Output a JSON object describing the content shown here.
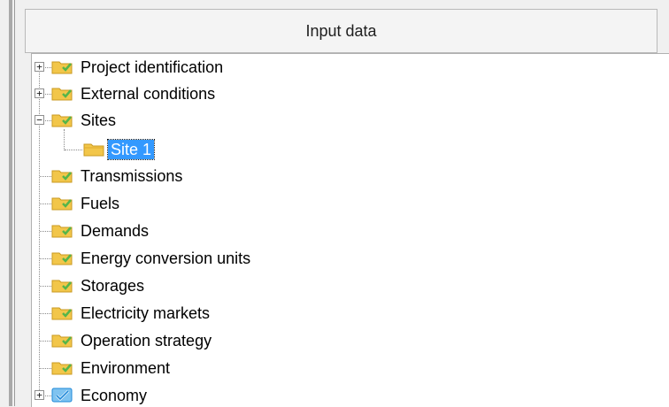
{
  "header": {
    "title": "Input data"
  },
  "tree": {
    "items": [
      {
        "label": "Project identification",
        "expander": "+",
        "icon": "folder-checked-icon"
      },
      {
        "label": "External conditions",
        "expander": "+",
        "icon": "folder-checked-icon"
      },
      {
        "label": "Sites",
        "expander": "−",
        "icon": "folder-checked-icon"
      },
      {
        "label": "Site 1",
        "expander": "",
        "icon": "folder-icon",
        "selected": true
      },
      {
        "label": "Transmissions",
        "expander": "",
        "icon": "folder-checked-icon"
      },
      {
        "label": "Fuels",
        "expander": "",
        "icon": "folder-checked-icon"
      },
      {
        "label": "Demands",
        "expander": "",
        "icon": "folder-checked-icon"
      },
      {
        "label": "Energy conversion units",
        "expander": "",
        "icon": "folder-checked-icon"
      },
      {
        "label": "Storages",
        "expander": "",
        "icon": "folder-checked-icon"
      },
      {
        "label": "Electricity markets",
        "expander": "",
        "icon": "folder-checked-icon"
      },
      {
        "label": "Operation strategy",
        "expander": "",
        "icon": "folder-checked-icon"
      },
      {
        "label": "Environment",
        "expander": "",
        "icon": "folder-checked-icon"
      },
      {
        "label": "Economy",
        "expander": "+",
        "icon": "blue-check-icon"
      }
    ]
  },
  "colors": {
    "folder": "#f2c64a",
    "check_green": "#55b54a",
    "check_blue": "#1e88d8",
    "selection": "#3399ff"
  }
}
